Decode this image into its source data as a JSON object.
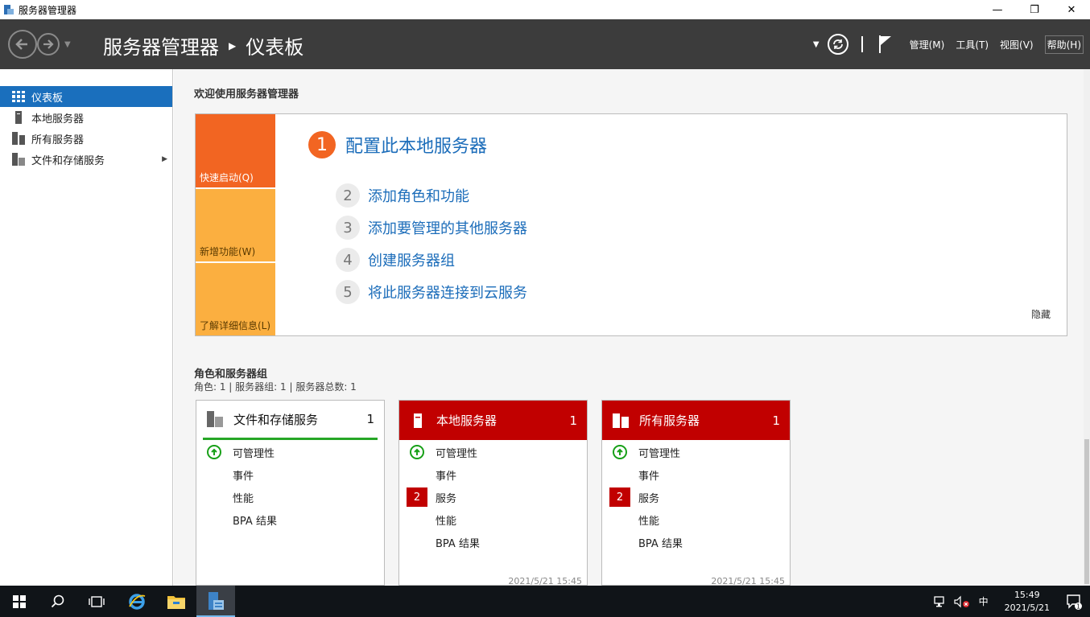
{
  "window": {
    "title": "服务器管理器",
    "minimize": "—",
    "maximize": "❐",
    "close": "✕"
  },
  "header": {
    "breadcrumb_root": "服务器管理器",
    "breadcrumb_current": "仪表板",
    "menus": [
      "管理(M)",
      "工具(T)",
      "视图(V)",
      "帮助(H)"
    ]
  },
  "sidebar": {
    "items": [
      {
        "label": "仪表板",
        "icon": "dashboard-icon",
        "active": true
      },
      {
        "label": "本地服务器",
        "icon": "server-icon",
        "active": false
      },
      {
        "label": "所有服务器",
        "icon": "servers-icon",
        "active": false
      },
      {
        "label": "文件和存储服务",
        "icon": "file-storage-icon",
        "active": false
      }
    ]
  },
  "welcome": {
    "title": "欢迎使用服务器管理器",
    "quick_tiles": [
      "快速启动(Q)",
      "新增功能(W)",
      "了解详细信息(L)"
    ],
    "steps": [
      {
        "num": "1",
        "label": "配置此本地服务器"
      },
      {
        "num": "2",
        "label": "添加角色和功能"
      },
      {
        "num": "3",
        "label": "添加要管理的其他服务器"
      },
      {
        "num": "4",
        "label": "创建服务器组"
      },
      {
        "num": "5",
        "label": "将此服务器连接到云服务"
      }
    ],
    "hide": "隐藏"
  },
  "roles": {
    "title": "角色和服务器组",
    "subtitle": "角色: 1 | 服务器组: 1 | 服务器总数: 1",
    "cards": [
      {
        "name": "文件和存储服务",
        "count": "1",
        "rows": [
          "可管理性",
          "事件",
          "性能",
          "BPA 结果"
        ],
        "timestamp": ""
      },
      {
        "name": "本地服务器",
        "count": "1",
        "rows": [
          "可管理性",
          "事件",
          "服务",
          "性能",
          "BPA 结果"
        ],
        "badge": "2",
        "timestamp": "2021/5/21 15:45"
      },
      {
        "name": "所有服务器",
        "count": "1",
        "rows": [
          "可管理性",
          "事件",
          "服务",
          "性能",
          "BPA 结果"
        ],
        "badge": "2",
        "timestamp": "2021/5/21 15:45"
      }
    ]
  },
  "taskbar": {
    "ime": "中",
    "time": "15:49",
    "date": "2021/5/21",
    "notification_count": "1"
  },
  "colors": {
    "accent": "#1a6fbd",
    "quickstart": "#f26522",
    "tile": "#fbaf40",
    "alert": "#c10000",
    "ok": "#18a018"
  }
}
